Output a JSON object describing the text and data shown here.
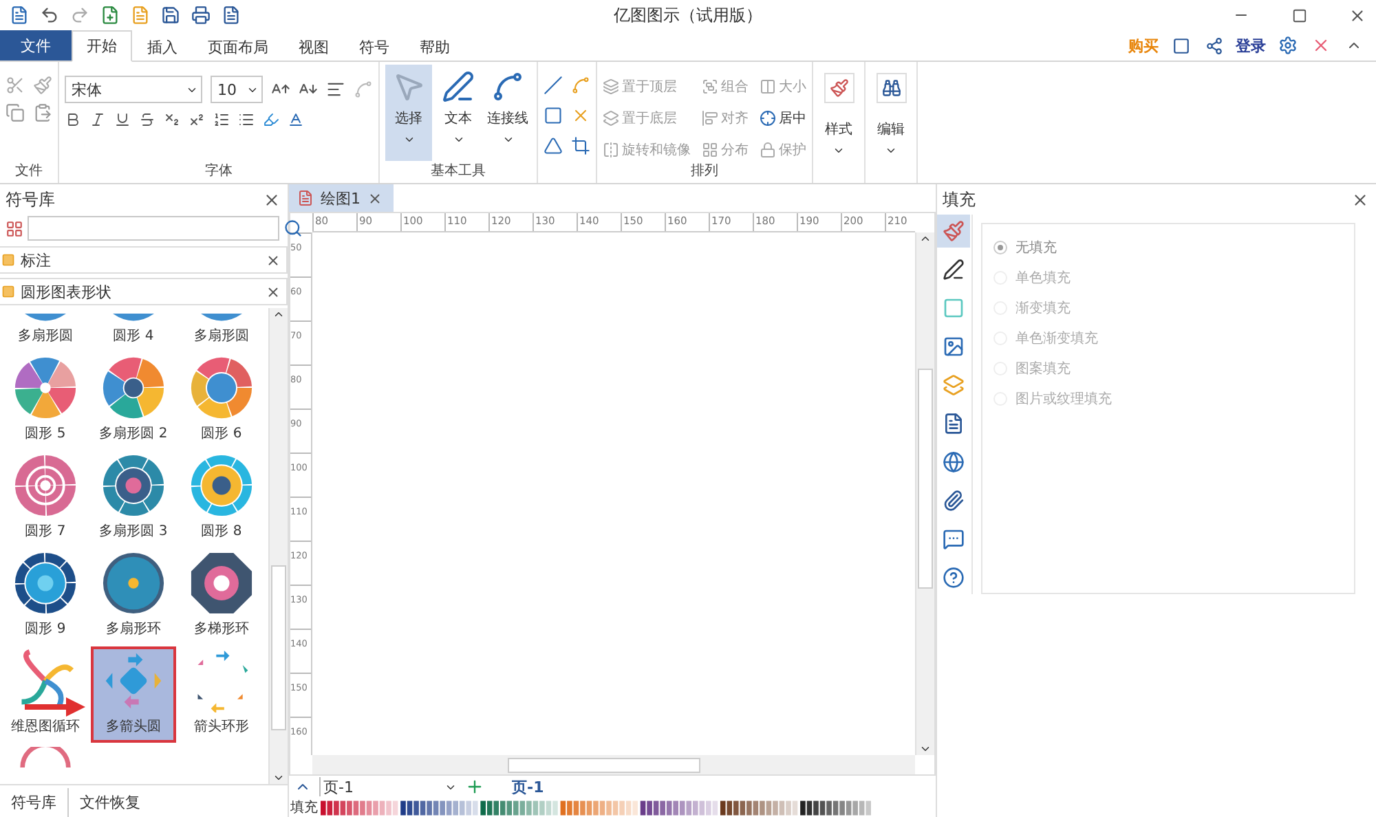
{
  "window": {
    "title": "亿图图示（试用版）"
  },
  "menu": {
    "file_tab": "文件",
    "tabs": [
      {
        "label": "开始",
        "selected": true
      },
      {
        "label": "插入",
        "selected": false
      },
      {
        "label": "页面布局",
        "selected": false
      },
      {
        "label": "视图",
        "selected": false
      },
      {
        "label": "符号",
        "selected": false
      },
      {
        "label": "帮助",
        "selected": false
      }
    ],
    "buy": "购买",
    "login": "登录"
  },
  "ribbon": {
    "groups": [
      {
        "kind": "clipboard",
        "label": "文件"
      },
      {
        "kind": "font",
        "label": "字体",
        "font": "宋体",
        "size": "10"
      },
      {
        "kind": "tools",
        "label": "基本工具",
        "tools": [
          {
            "label": "选择",
            "selected": true
          },
          {
            "label": "文本",
            "selected": false
          },
          {
            "label": "连接线",
            "selected": false
          }
        ]
      },
      {
        "kind": "shapes"
      },
      {
        "kind": "arrange",
        "label": "排列",
        "items": [
          {
            "label": "置于顶层",
            "disabled": true
          },
          {
            "label": "组合",
            "disabled": true
          },
          {
            "label": "大小",
            "disabled": true
          },
          {
            "label": "置于底层",
            "disabled": true
          },
          {
            "label": "对齐",
            "disabled": true
          },
          {
            "label": "居中",
            "disabled": false
          },
          {
            "label": "旋转和镜像",
            "disabled": true
          },
          {
            "label": "分布",
            "disabled": true
          },
          {
            "label": "保护",
            "disabled": true
          }
        ]
      },
      {
        "kind": "style",
        "label": "样式"
      },
      {
        "kind": "edit",
        "label": "编辑"
      }
    ]
  },
  "library": {
    "title": "符号库",
    "categories": [
      {
        "label": "标注"
      },
      {
        "label": "圆形图表形状"
      }
    ],
    "shapes": [
      {
        "label": "多扇形圆",
        "kind": "cut",
        "selected": false
      },
      {
        "label": "圆形 4",
        "kind": "cut",
        "selected": false
      },
      {
        "label": "多扇形圆",
        "kind": "cut",
        "selected": false
      },
      {
        "label": "圆形 5",
        "kind": "sectors",
        "selected": false
      },
      {
        "label": "多扇形圆 2",
        "kind": "donut",
        "selected": false
      },
      {
        "label": "圆形 6",
        "kind": "ring",
        "selected": false
      },
      {
        "label": "圆形 7",
        "kind": "target",
        "selected": false
      },
      {
        "label": "多扇形圆 3",
        "kind": "donut2",
        "selected": false
      },
      {
        "label": "圆形 8",
        "kind": "ring2",
        "selected": false
      },
      {
        "label": "圆形 9",
        "kind": "target2",
        "selected": false
      },
      {
        "label": "多扇形环",
        "kind": "wheel",
        "selected": false
      },
      {
        "label": "多梯形环",
        "kind": "octagon",
        "selected": false
      },
      {
        "label": "维恩图循环",
        "kind": "venn",
        "selected": false
      },
      {
        "label": "多箭头圆",
        "kind": "arrows",
        "selected": true
      },
      {
        "label": "箭头环形",
        "kind": "arrowring",
        "selected": false
      },
      {
        "kind": "arc",
        "selected": false
      }
    ],
    "bottom_tabs": [
      {
        "label": "符号库",
        "selected": true
      },
      {
        "label": "文件恢复",
        "selected": false
      }
    ]
  },
  "document": {
    "tab": "绘图1",
    "hruler": [
      "80",
      "90",
      "100",
      "110",
      "120",
      "130",
      "140",
      "150",
      "160",
      "170",
      "180",
      "190",
      "200",
      "210"
    ],
    "vruler": [
      "50",
      "60",
      "70",
      "80",
      "90",
      "100",
      "110",
      "120",
      "130",
      "140",
      "150",
      "160"
    ],
    "page_select": "页-1",
    "page_tabs": [
      {
        "label": "页-1",
        "selected": true
      }
    ],
    "fill_label": "填充"
  },
  "fill_panel": {
    "title": "填充",
    "side": [
      {
        "kind": "fill",
        "selected": true
      },
      {
        "kind": "line",
        "selected": false
      },
      {
        "kind": "color",
        "selected": false
      },
      {
        "kind": "image",
        "selected": false
      },
      {
        "kind": "shadow",
        "selected": false
      },
      {
        "kind": "list",
        "selected": false
      },
      {
        "kind": "globe",
        "selected": false
      },
      {
        "kind": "attach",
        "selected": false
      },
      {
        "kind": "comment",
        "selected": false
      },
      {
        "kind": "help",
        "selected": false
      }
    ],
    "options": [
      {
        "label": "无填充",
        "selected": true
      },
      {
        "label": "单色填充",
        "selected": false
      },
      {
        "label": "渐变填充",
        "selected": false
      },
      {
        "label": "单色渐变填充",
        "selected": false
      },
      {
        "label": "图案填充",
        "selected": false
      },
      {
        "label": "图片或纹理填充",
        "selected": false
      }
    ]
  }
}
